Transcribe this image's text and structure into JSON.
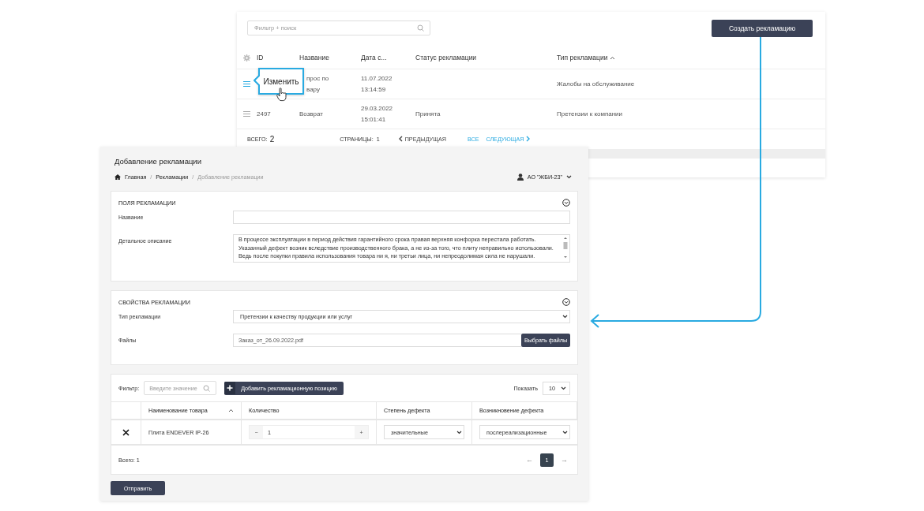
{
  "list_panel": {
    "search": {
      "placeholder": "Фильтр + поиск"
    },
    "create_button": "Создать рекламацию",
    "columns": [
      {
        "label": "ID",
        "sorted": false
      },
      {
        "label": "Название",
        "sorted": false
      },
      {
        "label": "Дата с...",
        "sorted": false
      },
      {
        "label": "Статус рекламации",
        "sorted": false
      },
      {
        "label": "Тип рекламации",
        "sorted": true
      }
    ],
    "rows": [
      {
        "highlighted": true,
        "name": "прос по вару",
        "date": "11.07.2022",
        "time": "13:14:59",
        "type": "Жалобы на обслуживание"
      },
      {
        "highlighted": false,
        "id": "2497",
        "name": "Возврат",
        "date": "29.03.2022",
        "time": "15:01:41",
        "status": "Принята",
        "type": "Претензии к компании"
      }
    ],
    "tooltip": {
      "label": "Изменить"
    },
    "pager": {
      "total_label": "ВСЕГО:",
      "total": "2",
      "pages_label": "СТРАНИЦЫ:",
      "page": "1",
      "prev": {
        "label": "ПРЕДЫДУЩАЯ",
        "disabled": true
      },
      "all": "ВСЕ",
      "next": {
        "label": "СЛЕДУЮЩАЯ",
        "disabled": false
      }
    }
  },
  "form_panel": {
    "title": "Добавление рекламации",
    "breadcrumbs": [
      {
        "label": "Главная",
        "current": false
      },
      {
        "separator": "/",
        "label": "Рекламации",
        "current": false
      },
      {
        "separator": "/",
        "label": "Добавление рекламации",
        "current": true
      }
    ],
    "account": "АО \"ЖБИ-23\"",
    "sections": [
      {
        "title": "ПОЛЯ РЕКЛАМАЦИИ",
        "fields": [
          {
            "kind": "text",
            "label": "Название"
          },
          {
            "kind": "textarea",
            "label": "Детальное описание",
            "value": "В процессе эксплуатации в период действия гарантийного срока правая верхняя конфорка перестала работать. Указанный дефект возник вследствие производственного брака, а не из-за того, что плиту неправильно использовали. Ведь после покупки правила использования товара ни я, ни третьи лица, ни непреодолимая сила не нарушали."
          }
        ]
      },
      {
        "title": "СВОЙСТВА РЕКЛАМАЦИИ",
        "fields": [
          {
            "kind": "select",
            "label": "Тип рекламации",
            "value": "Претензии к качеству продукции или услуг"
          },
          {
            "kind": "file",
            "label": "Файлы",
            "value": "Заказ_от_26.09.2022.pdf",
            "button": "Выбрать файлы"
          }
        ]
      }
    ],
    "positions": {
      "filter_label": "Фильтр:",
      "filter_placeholder": "Введите значение",
      "add_button": "Добавить рекламационную позицию",
      "show_label": "Показать",
      "page_size": "10",
      "columns": [
        {
          "label": "Наименование товара",
          "sorted": true
        },
        {
          "label": "Количество",
          "sorted": false
        },
        {
          "label": "Степень дефекта",
          "sorted": false
        },
        {
          "label": "Возникновение дефекта",
          "sorted": false
        }
      ],
      "rows": [
        {
          "product": "Плита ENDEVER IP-26",
          "minus": "−",
          "quantity": "1",
          "plus": "+",
          "severity": "значительные",
          "occurrence": "послереализационные"
        }
      ],
      "total_label": "Всего:",
      "total": "1",
      "prev": "←",
      "pages": [
        {
          "label": "1",
          "selected": true
        }
      ],
      "next": "→"
    },
    "submit": "Отправить"
  }
}
